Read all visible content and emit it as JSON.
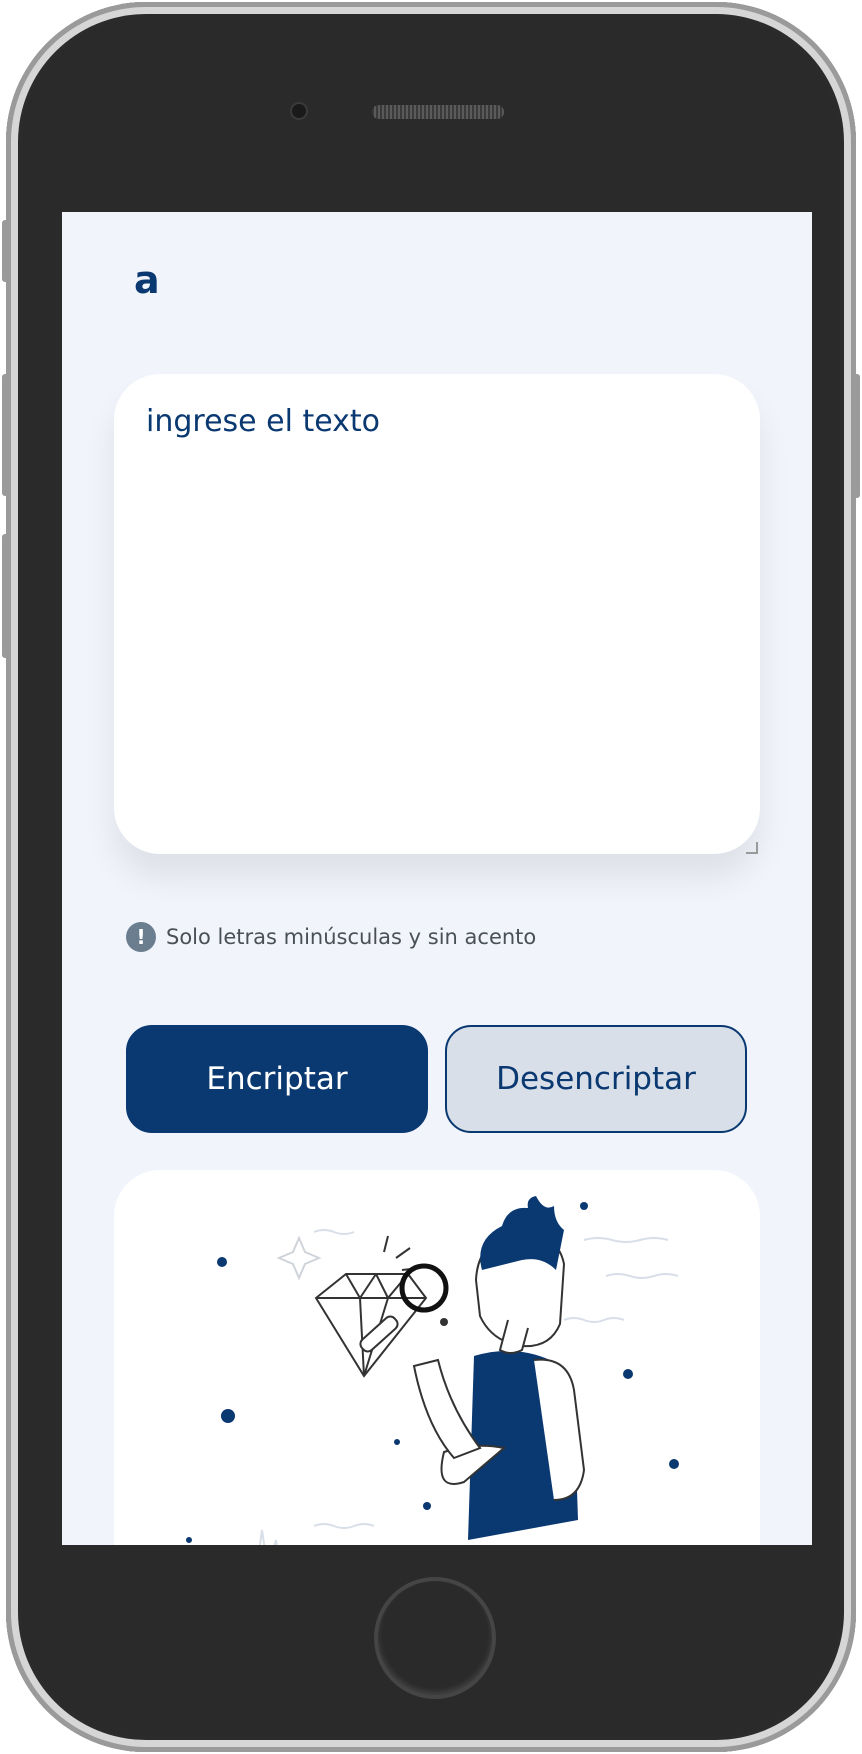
{
  "app": {
    "logo_text": "a",
    "input_placeholder": "ingrese el texto",
    "info_text": "Solo letras minúsculas y sin acento",
    "info_icon_glyph": "!",
    "encrypt_label": "Encriptar",
    "decrypt_label": "Desencriptar"
  },
  "colors": {
    "accent": "#0a3871",
    "background": "#f1f4fb",
    "card": "#ffffff",
    "secondary_button": "#d8dfe8",
    "info_icon": "#6b7e90"
  },
  "icons": {
    "logo": "alura-logo-icon",
    "info": "exclamation-icon",
    "illustration": "person-with-magnifier-illustration"
  }
}
